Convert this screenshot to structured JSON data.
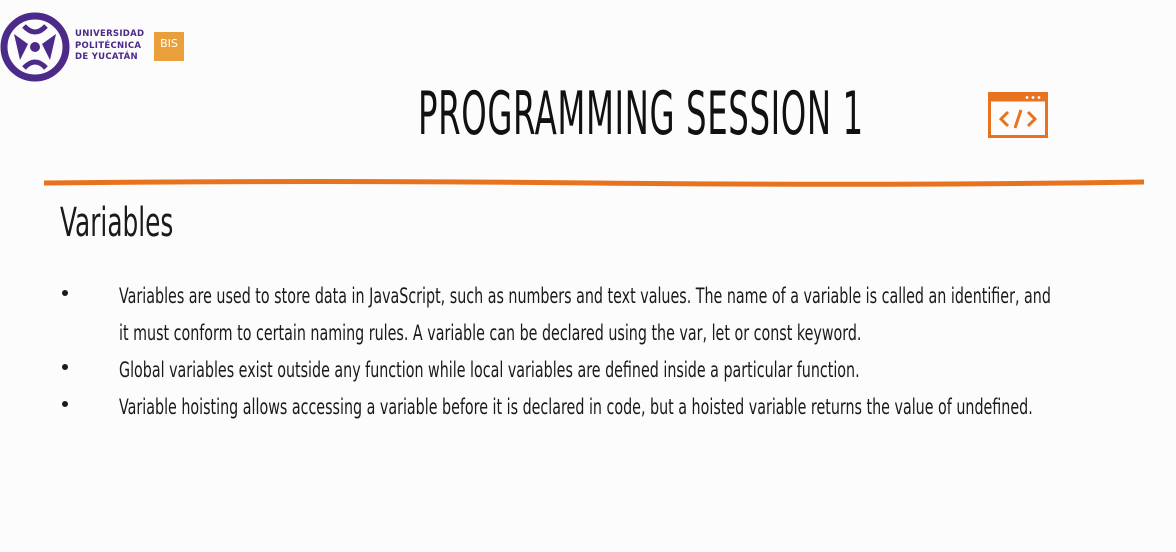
{
  "logo": {
    "line1": "UNIVERSIDAD",
    "line2": "POLITÉCNICA",
    "line3": "DE YUCATÁN",
    "badge": "BIS",
    "emblem_icon": "upy-emblem-icon"
  },
  "header": {
    "title": "PROGRAMMING SESSION 1",
    "icon": "code-window-icon"
  },
  "section": {
    "heading": "Variables"
  },
  "bullets": [
    {
      "line1": "Variables are used to store data in JavaScript, such as numbers and text values. The name of a variable is called an identifier, and",
      "line2": "it must conform to certain naming rules. A variable can be declared using the var, let or const keyword."
    },
    {
      "line1": "Global variables exist outside any function while local variables are defined inside a particular function."
    },
    {
      "line1": "Variable hoisting allows accessing a variable before it is declared in code, but a hoisted variable returns the value of undefined."
    }
  ],
  "colors": {
    "accent": "#e8731f",
    "brand_purple": "#4b2a8a",
    "badge": "#e9a03b"
  }
}
